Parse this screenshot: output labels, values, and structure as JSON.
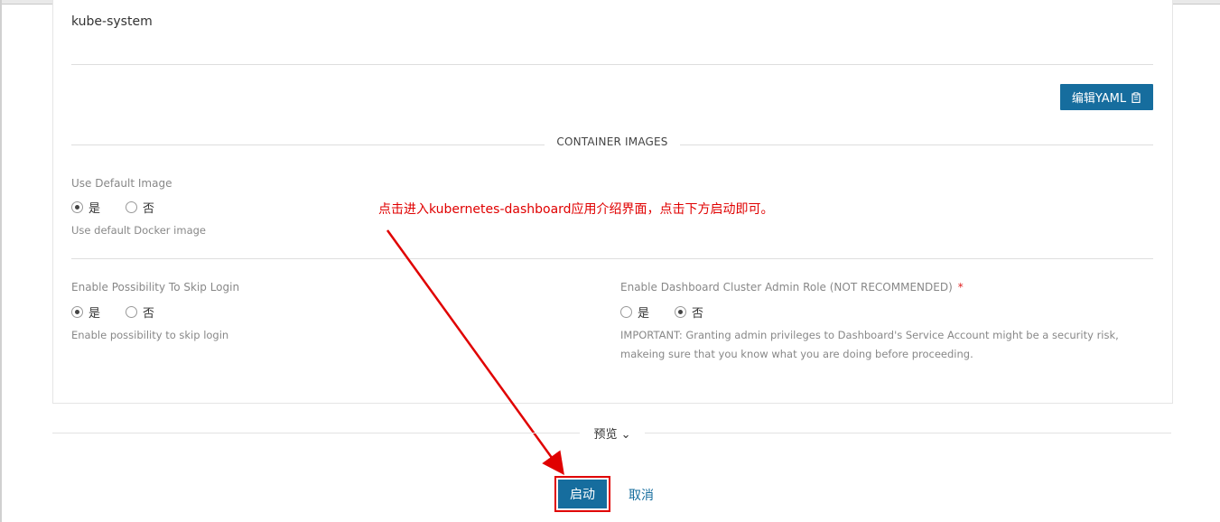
{
  "namespace": {
    "value": "kube-system"
  },
  "toolbar": {
    "edit_yaml_label": "编辑YAML"
  },
  "section": {
    "title": "CONTAINER IMAGES"
  },
  "fields": {
    "default_image": {
      "label": "Use Default Image",
      "options": [
        "是",
        "否"
      ],
      "selected": "是",
      "hint": "Use default Docker image"
    },
    "skip_login": {
      "label": "Enable Possibility To Skip Login",
      "options": [
        "是",
        "否"
      ],
      "selected": "是",
      "hint": "Enable possibility to skip login"
    },
    "cluster_admin": {
      "label": "Enable Dashboard Cluster Admin Role (NOT RECOMMENDED)",
      "required_mark": "*",
      "options": [
        "是",
        "否"
      ],
      "selected": "否",
      "hint_line1": "IMPORTANT: Granting admin privileges to Dashboard's Service Account might be a security risk,",
      "hint_line2": "makeing sure that you know what you are doing before proceeding."
    }
  },
  "annotation": {
    "text": "点击进入kubernetes-dashboard应用介绍界面，点击下方启动即可。",
    "color": "#e00000"
  },
  "footer": {
    "preview_label": "预览",
    "start_label": "启动",
    "cancel_label": "取消"
  },
  "colors": {
    "accent": "#166d9e",
    "annotation": "#e00000"
  }
}
